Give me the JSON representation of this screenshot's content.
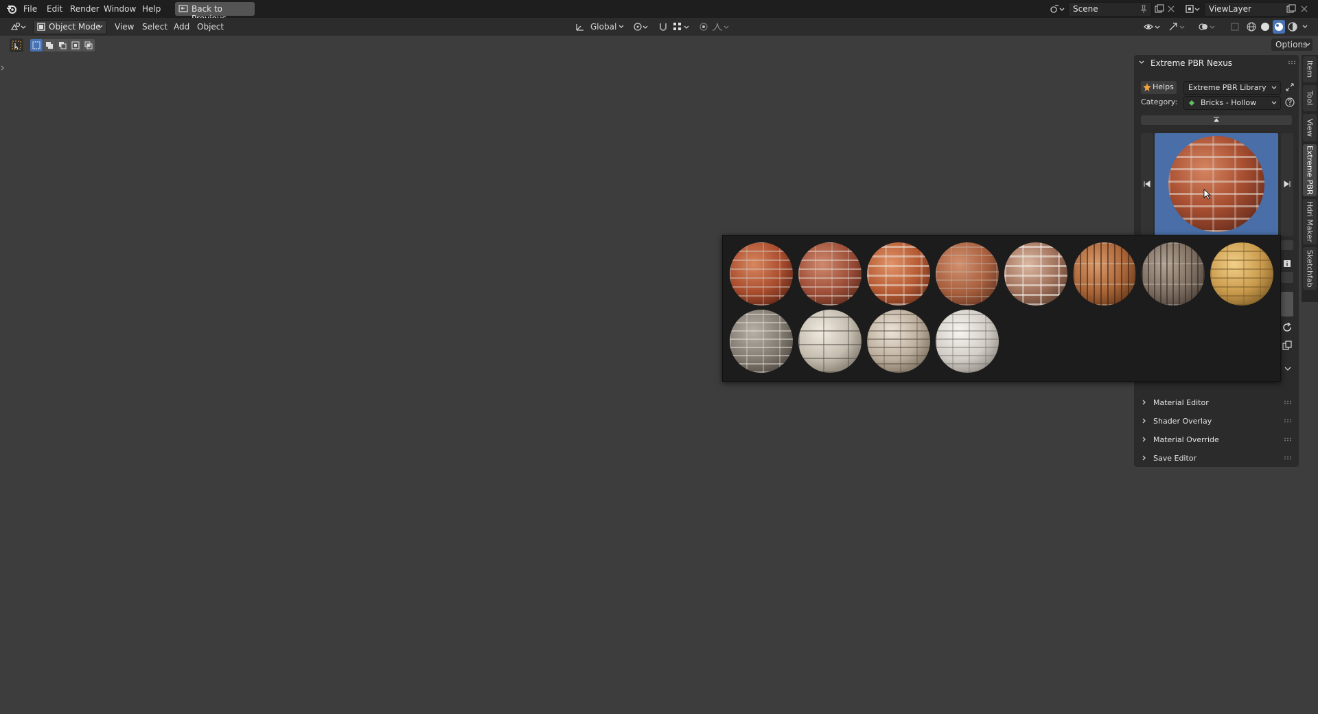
{
  "menubar": {
    "items": [
      "File",
      "Edit",
      "Render",
      "Window",
      "Help"
    ],
    "back_button": "Back to Previous",
    "scene": "Scene",
    "view_layer": "ViewLayer"
  },
  "header": {
    "mode": "Object Mode",
    "menus": [
      "View",
      "Select",
      "Add",
      "Object"
    ],
    "transform_orientation": "Global",
    "options": "Options"
  },
  "panel": {
    "title": "Extreme PBR Nexus",
    "helps": "Helps",
    "library": "Extreme PBR Library",
    "category_label": "Category:",
    "category_value": "Bricks - Hollow",
    "subpanels": [
      "Material Editor",
      "Shader Overlay",
      "Material Override",
      "Save Editor"
    ]
  },
  "side_tabs": [
    "Item",
    "Tool",
    "View",
    "Extreme PBR",
    "Hdri Maker",
    "Sketchfab"
  ],
  "colors": {
    "accent": "#4772b3",
    "preview_bg": "#4a6fa8",
    "category_dot": "#5ec45e"
  },
  "icons": {
    "blender": "blender-logo-icon",
    "cursor": "mouse-cursor-icon"
  }
}
